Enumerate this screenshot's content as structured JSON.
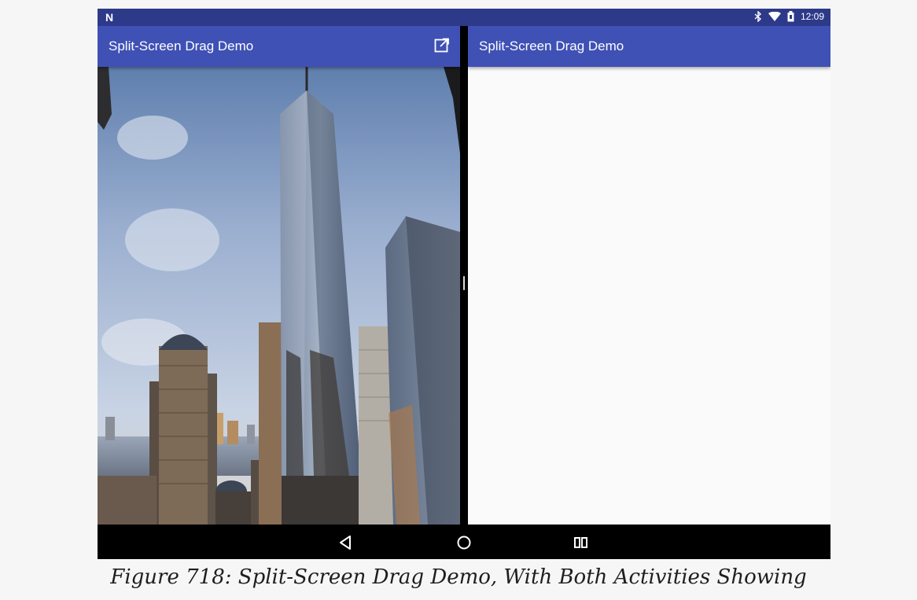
{
  "status_bar": {
    "left_icon": "n-notification-icon",
    "time": "12:09",
    "icons": [
      "bluetooth-icon",
      "wifi-icon",
      "battery-icon"
    ]
  },
  "left_pane": {
    "title": "Split-Screen Drag Demo",
    "action_icon": "open-in-new-window-icon",
    "image": "photo of a tall glass skyscraper and city buildings against a blue sky"
  },
  "right_pane": {
    "title": "Split-Screen Drag Demo"
  },
  "nav_bar": {
    "buttons": [
      "back-icon",
      "home-icon",
      "recents-icon"
    ]
  },
  "caption": "Figure 718: Split-Screen Drag Demo, With Both Activities Showing",
  "colors": {
    "appbar": "#3f51b5",
    "statusbar": "#2d3a8a",
    "content_bg": "#fafafa"
  }
}
